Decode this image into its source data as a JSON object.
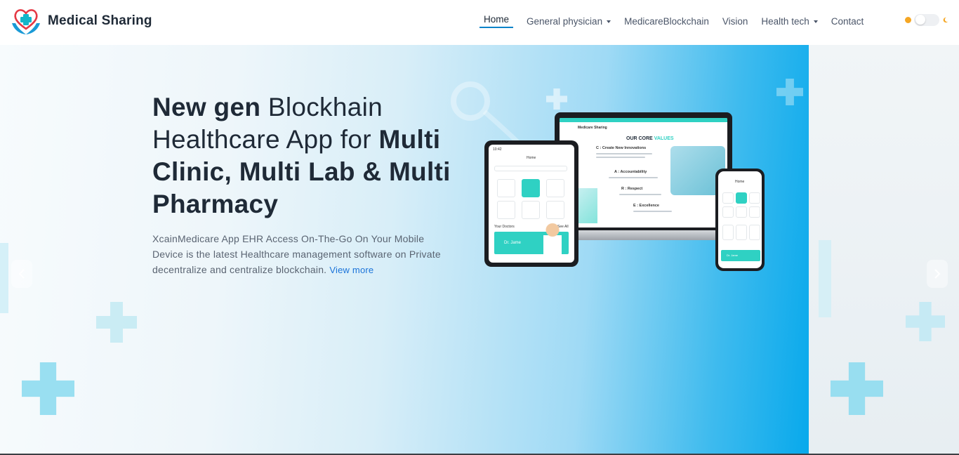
{
  "brand": {
    "name": "Medical Sharing",
    "logo_icon": "heart-hands-cross-icon"
  },
  "nav": {
    "items": [
      {
        "label": "Home",
        "active": true,
        "dropdown": false
      },
      {
        "label": "General physician",
        "active": false,
        "dropdown": true
      },
      {
        "label": "MedicareBlockchain",
        "active": false,
        "dropdown": false
      },
      {
        "label": "Vision",
        "active": false,
        "dropdown": false
      },
      {
        "label": "Health tech",
        "active": false,
        "dropdown": true
      },
      {
        "label": "Contact",
        "active": false,
        "dropdown": false
      }
    ],
    "accent_color": "#0c83c9"
  },
  "theme_toggle": {
    "sun_icon": "sun-icon",
    "moon_icon": "moon-icon",
    "state": "light"
  },
  "hero": {
    "title_bold_1": "New gen",
    "title_light_1": "Blockhain Healthcare App for",
    "title_bold_2": "Multi Clinic, Multi Lab & Multi Pharmacy",
    "description": "XcainMedicare App EHR Access On-The-Go On Your Mobile Device is the latest Healthcare management software on Private decentralize and centralize blockchain.",
    "view_more": "View more",
    "link_color": "#1a73d9",
    "prev_icon": "chevron-left-icon",
    "next_icon": "chevron-right-icon"
  },
  "mockup": {
    "laptop": {
      "site_name": "Medicare Sharing",
      "heading_prefix": "OUR CORE",
      "heading_accent": "VALUES",
      "values": [
        "C : Create New Innovations",
        "A : Accountability",
        "R : Respect",
        "E : Excellence"
      ]
    },
    "tablet": {
      "time": "10:42",
      "title": "Home",
      "section": "Your Doctors",
      "see_all": "See All",
      "doctor": "Dr. Jame"
    },
    "phone": {
      "title": "Home",
      "doctor": "Dr. Jame"
    },
    "accent_color": "#2fd1c3"
  }
}
